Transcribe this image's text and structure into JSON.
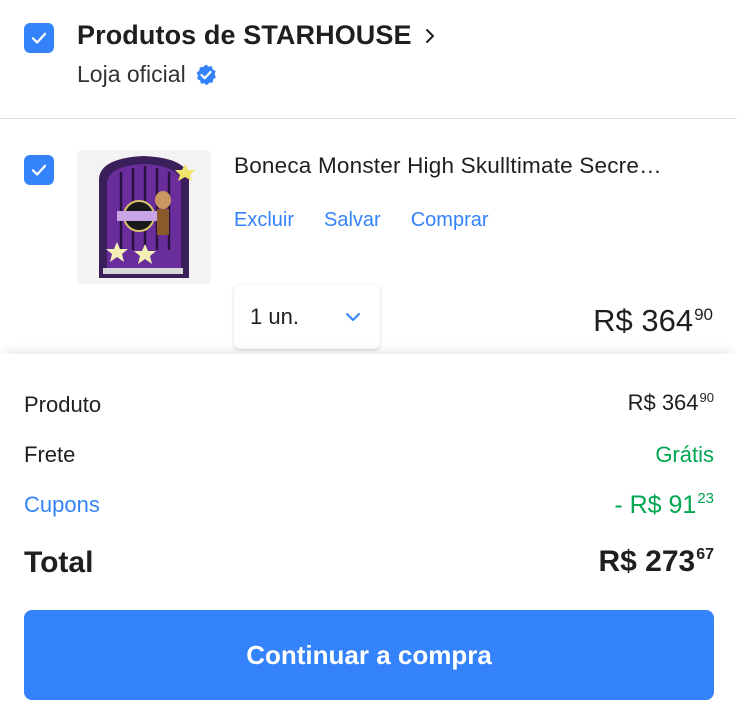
{
  "seller": {
    "title": "Produtos de STARHOUSE",
    "badge_text": "Loja oficial",
    "selected": true
  },
  "product": {
    "selected": true,
    "title": "Boneca Monster High Skulltimate Secre…",
    "image_alt": "Boneca Monster High Skulltimate Secrets",
    "actions": {
      "delete": "Excluir",
      "save": "Salvar",
      "buy": "Comprar"
    },
    "quantity": "1 un.",
    "price_int": "R$ 364",
    "price_cents": "90"
  },
  "summary": {
    "product_label": "Produto",
    "product_int": "R$ 364",
    "product_cents": "90",
    "shipping_label": "Frete",
    "shipping_value": "Grátis",
    "coupons_label": "Cupons",
    "coupons_int": "- R$ 91",
    "coupons_cents": "23",
    "total_label": "Total",
    "total_int": "R$ 273",
    "total_cents": "67"
  },
  "cta": {
    "label": "Continuar a compra"
  },
  "colors": {
    "accent": "#3483fa",
    "success": "#00a650",
    "text": "#1f1f1f"
  },
  "icons": {
    "checkbox": "check-icon",
    "seller_chevron": "chevron-right-icon",
    "verified": "verified-badge-icon",
    "qty_chevron": "chevron-down-icon"
  }
}
